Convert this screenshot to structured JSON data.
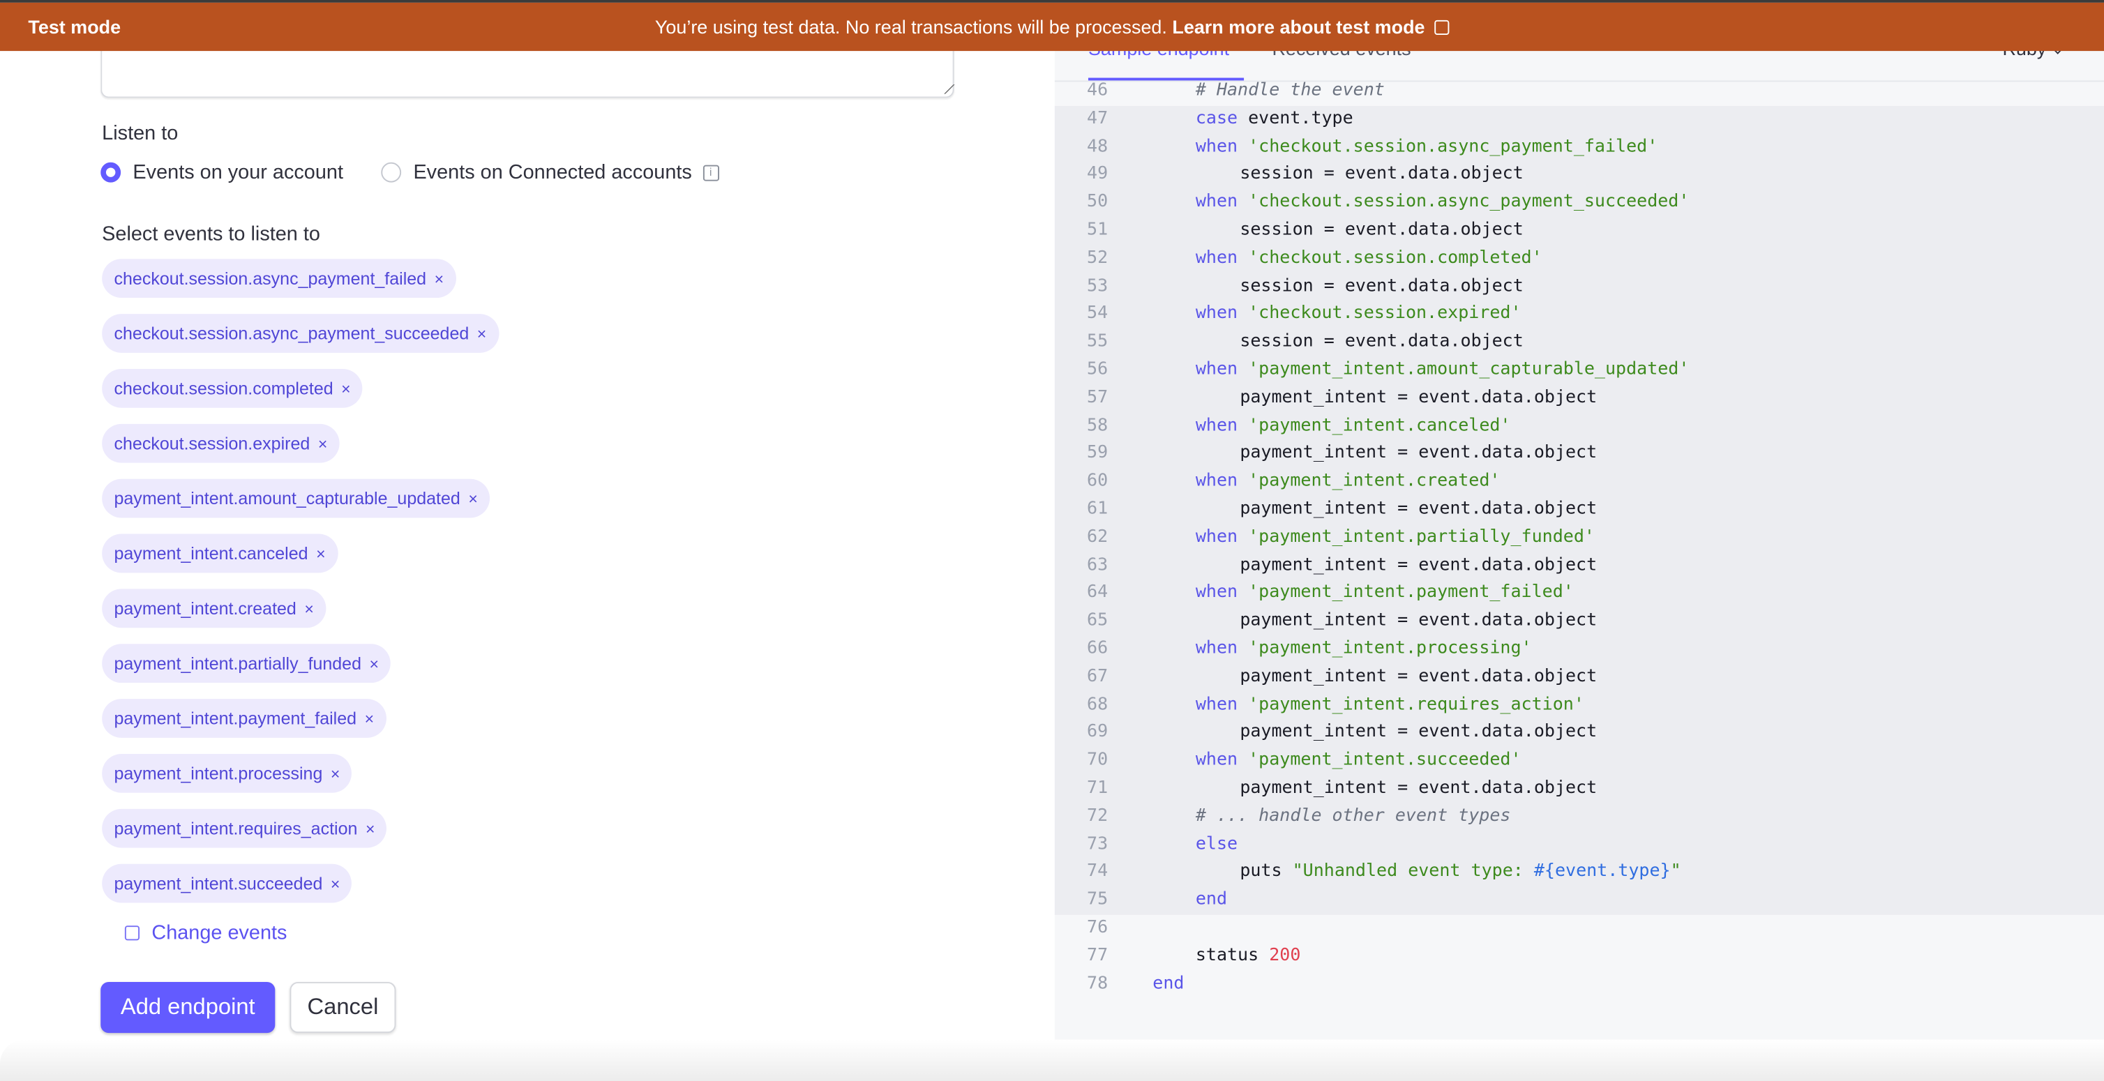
{
  "banner": {
    "mode_label": "Test mode",
    "message": "You’re using test data. No real transactions will be processed.",
    "link": "Learn more about test mode",
    "color": "#b9521f"
  },
  "form": {
    "listen_to_label": "Listen to",
    "radio_options": [
      {
        "label": "Events on your account",
        "selected": true
      },
      {
        "label": "Events on Connected accounts",
        "selected": false
      }
    ],
    "select_events_label": "Select events to listen to",
    "selected_events": [
      "checkout.session.async_payment_failed",
      "checkout.session.async_payment_succeeded",
      "checkout.session.completed",
      "checkout.session.expired",
      "payment_intent.amount_capturable_updated",
      "payment_intent.canceled",
      "payment_intent.created",
      "payment_intent.partially_funded",
      "payment_intent.payment_failed",
      "payment_intent.processing",
      "payment_intent.requires_action",
      "payment_intent.succeeded"
    ],
    "remove_glyph": "×",
    "change_events_label": "Change events",
    "add_endpoint_label": "Add endpoint",
    "cancel_label": "Cancel",
    "accent": "#635bff"
  },
  "code_panel": {
    "tabs": [
      {
        "label": "Sample endpoint",
        "active": true
      },
      {
        "label": "Received events",
        "active": false
      }
    ],
    "language": "Ruby",
    "lines": [
      {
        "n": "46",
        "ind": 2,
        "t": [
          [
            "c",
            "# Handle the event"
          ]
        ]
      },
      {
        "n": "47",
        "ind": 2,
        "t": [
          [
            "k",
            "case"
          ],
          [
            "",
            " event.type"
          ]
        ]
      },
      {
        "n": "48",
        "ind": 2,
        "t": [
          [
            "k",
            "when"
          ],
          [
            "",
            " "
          ],
          [
            "s",
            "'checkout.session.async_payment_failed'"
          ]
        ]
      },
      {
        "n": "49",
        "ind": 3,
        "t": [
          [
            "",
            "session = event.data.object"
          ]
        ]
      },
      {
        "n": "50",
        "ind": 2,
        "t": [
          [
            "k",
            "when"
          ],
          [
            "",
            " "
          ],
          [
            "s",
            "'checkout.session.async_payment_succeeded'"
          ]
        ]
      },
      {
        "n": "51",
        "ind": 3,
        "t": [
          [
            "",
            "session = event.data.object"
          ]
        ]
      },
      {
        "n": "52",
        "ind": 2,
        "t": [
          [
            "k",
            "when"
          ],
          [
            "",
            " "
          ],
          [
            "s",
            "'checkout.session.completed'"
          ]
        ]
      },
      {
        "n": "53",
        "ind": 3,
        "t": [
          [
            "",
            "session = event.data.object"
          ]
        ]
      },
      {
        "n": "54",
        "ind": 2,
        "t": [
          [
            "k",
            "when"
          ],
          [
            "",
            " "
          ],
          [
            "s",
            "'checkout.session.expired'"
          ]
        ]
      },
      {
        "n": "55",
        "ind": 3,
        "t": [
          [
            "",
            "session = event.data.object"
          ]
        ]
      },
      {
        "n": "56",
        "ind": 2,
        "t": [
          [
            "k",
            "when"
          ],
          [
            "",
            " "
          ],
          [
            "s",
            "'payment_intent.amount_capturable_updated'"
          ]
        ]
      },
      {
        "n": "57",
        "ind": 3,
        "t": [
          [
            "",
            "payment_intent = event.data.object"
          ]
        ]
      },
      {
        "n": "58",
        "ind": 2,
        "t": [
          [
            "k",
            "when"
          ],
          [
            "",
            " "
          ],
          [
            "s",
            "'payment_intent.canceled'"
          ]
        ]
      },
      {
        "n": "59",
        "ind": 3,
        "t": [
          [
            "",
            "payment_intent = event.data.object"
          ]
        ]
      },
      {
        "n": "60",
        "ind": 2,
        "t": [
          [
            "k",
            "when"
          ],
          [
            "",
            " "
          ],
          [
            "s",
            "'payment_intent.created'"
          ]
        ]
      },
      {
        "n": "61",
        "ind": 3,
        "t": [
          [
            "",
            "payment_intent = event.data.object"
          ]
        ]
      },
      {
        "n": "62",
        "ind": 2,
        "t": [
          [
            "k",
            "when"
          ],
          [
            "",
            " "
          ],
          [
            "s",
            "'payment_intent.partially_funded'"
          ]
        ]
      },
      {
        "n": "63",
        "ind": 3,
        "t": [
          [
            "",
            "payment_intent = event.data.object"
          ]
        ]
      },
      {
        "n": "64",
        "ind": 2,
        "t": [
          [
            "k",
            "when"
          ],
          [
            "",
            " "
          ],
          [
            "s",
            "'payment_intent.payment_failed'"
          ]
        ]
      },
      {
        "n": "65",
        "ind": 3,
        "t": [
          [
            "",
            "payment_intent = event.data.object"
          ]
        ]
      },
      {
        "n": "66",
        "ind": 2,
        "t": [
          [
            "k",
            "when"
          ],
          [
            "",
            " "
          ],
          [
            "s",
            "'payment_intent.processing'"
          ]
        ]
      },
      {
        "n": "67",
        "ind": 3,
        "t": [
          [
            "",
            "payment_intent = event.data.object"
          ]
        ]
      },
      {
        "n": "68",
        "ind": 2,
        "t": [
          [
            "k",
            "when"
          ],
          [
            "",
            " "
          ],
          [
            "s",
            "'payment_intent.requires_action'"
          ]
        ]
      },
      {
        "n": "69",
        "ind": 3,
        "t": [
          [
            "",
            "payment_intent = event.data.object"
          ]
        ]
      },
      {
        "n": "70",
        "ind": 2,
        "t": [
          [
            "k",
            "when"
          ],
          [
            "",
            " "
          ],
          [
            "s",
            "'payment_intent.succeeded'"
          ]
        ]
      },
      {
        "n": "71",
        "ind": 3,
        "t": [
          [
            "",
            "payment_intent = event.data.object"
          ]
        ]
      },
      {
        "n": "72",
        "ind": 2,
        "t": [
          [
            "c",
            "# ... handle other event types"
          ]
        ]
      },
      {
        "n": "73",
        "ind": 2,
        "t": [
          [
            "k",
            "else"
          ]
        ]
      },
      {
        "n": "74",
        "ind": 3,
        "t": [
          [
            "",
            "puts "
          ],
          [
            "s",
            "\"Unhandled event type: "
          ],
          [
            "i",
            "#{event.type}"
          ],
          [
            "s",
            "\""
          ]
        ]
      },
      {
        "n": "75",
        "ind": 2,
        "t": [
          [
            "k",
            "end"
          ]
        ]
      },
      {
        "n": "76",
        "ind": 1,
        "t": []
      },
      {
        "n": "77",
        "ind": 2,
        "t": [
          [
            "",
            "status "
          ],
          [
            "n",
            "200"
          ]
        ]
      },
      {
        "n": "78",
        "ind": 1,
        "t": [
          [
            "k",
            "end"
          ]
        ]
      }
    ]
  }
}
